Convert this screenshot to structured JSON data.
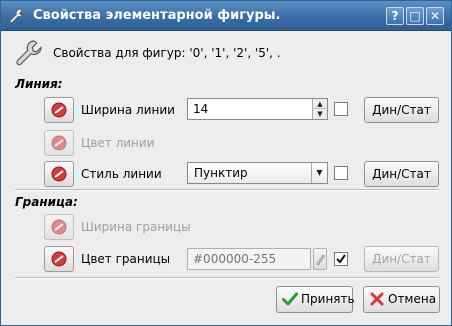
{
  "window": {
    "title": "Свойства элементарной фигуры.",
    "buttons": {
      "help": "?",
      "maximize": "□",
      "close": "✕"
    }
  },
  "info": {
    "text": "Свойства для фигур: '0', '1', '2', '5', ."
  },
  "sections": {
    "line": "Линия:",
    "border": "Граница:"
  },
  "properties": {
    "line_width": {
      "label": "Ширина линии",
      "value": "14",
      "dyn_button": "Дин/Стат"
    },
    "line_color": {
      "label": "Цвет линии"
    },
    "line_style": {
      "label": "Стиль линии",
      "value": "Пунктир",
      "dyn_button": "Дин/Стат"
    },
    "border_width": {
      "label": "Ширина границы"
    },
    "border_color": {
      "label": "Цвет границы",
      "value": "#000000-255",
      "dyn_button": "Дин/Стат"
    }
  },
  "footer": {
    "ok": "Принять",
    "cancel": "Отмена"
  },
  "colors": {
    "titlebar": "#3a6ea5",
    "background": "#ededed",
    "reset_icon": "#d63a3a",
    "ok_icon": "#2e9c2e",
    "cancel_icon": "#d63a3a"
  },
  "icons": {
    "app": "wrench-icon",
    "info": "wrench-icon",
    "reset": "reset-icon",
    "ok": "check-icon",
    "cancel": "cancel-x-icon"
  }
}
